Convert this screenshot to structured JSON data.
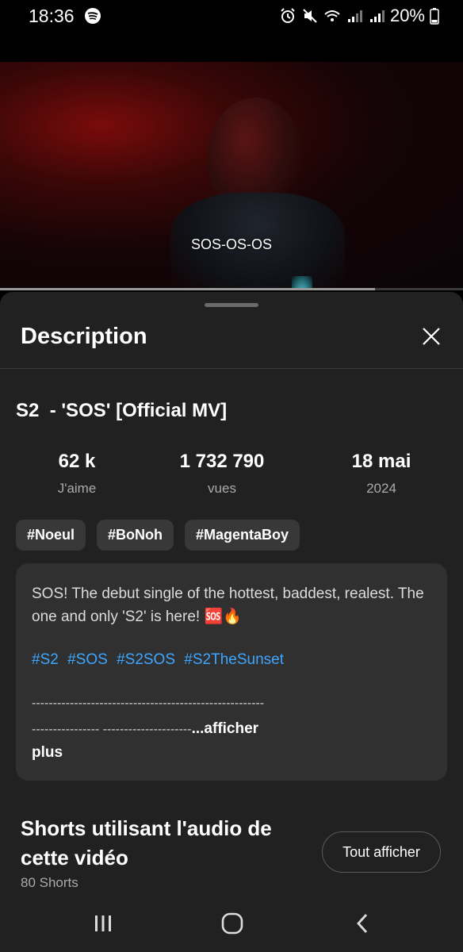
{
  "status_bar": {
    "time": "18:36",
    "battery": "20%"
  },
  "video": {
    "subtitle": "SOS-OS-OS",
    "progress": 0.81
  },
  "sheet": {
    "title": "Description",
    "video_title": "S2  - 'SOS' [Official MV]",
    "stats": [
      {
        "value": "62 k",
        "label": "J'aime"
      },
      {
        "value": "1 732 790",
        "label": "vues"
      },
      {
        "value": "18 mai",
        "label": "2024"
      }
    ],
    "tags": [
      "#Noeul",
      "#BoNoh",
      "#MagentaBoy"
    ],
    "description": {
      "text": "SOS! The debut single of the hottest, baddest, realest. The one and only 'S2' is here! 🆘🔥",
      "hashtags": [
        "#S2",
        "#SOS",
        "#S2SOS",
        "#S2TheSunset"
      ],
      "dashes_line1": "-------------------------------------------------------",
      "dashes_line2": "----------------    ---------------------",
      "more_label": "...afficher",
      "more_label2": "plus"
    },
    "shorts": {
      "title": "Shorts utilisant l'audio de cette vidéo",
      "count": "80 Shorts",
      "show_all": "Tout afficher"
    }
  },
  "colors": {
    "link": "#3ea6ff",
    "sheet_bg": "#212121",
    "card_bg": "#303030"
  }
}
